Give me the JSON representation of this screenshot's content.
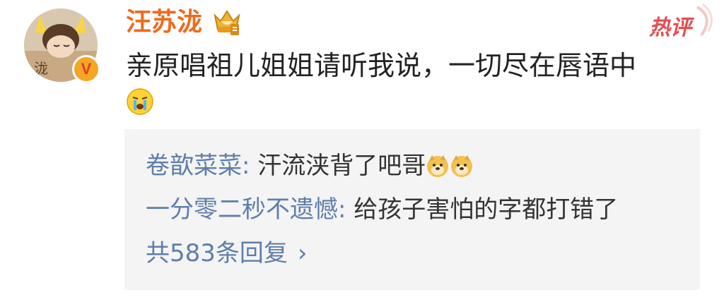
{
  "comment": {
    "username": "汪苏泷",
    "badge_label": "热评",
    "text": "亲原唱祖儿姐姐请听我说，一切尽在唇语中",
    "emoji": "crying-face-icon",
    "avatar_vip_mark": "V"
  },
  "replies": [
    {
      "author": "卷歆菜菜",
      "separator": ": ",
      "text": "汗流浃背了吧哥",
      "emojis": [
        "doge-icon",
        "doge-icon"
      ]
    },
    {
      "author": "一分零二秒不遗憾",
      "separator": ": ",
      "text": "给孩子害怕的字都打错了"
    }
  ],
  "more_replies": "共583条回复",
  "colors": {
    "username": "#f06a1b",
    "link": "#5e7ea9",
    "badge": "#e84c50",
    "reply_bg": "#f4f4f4"
  }
}
